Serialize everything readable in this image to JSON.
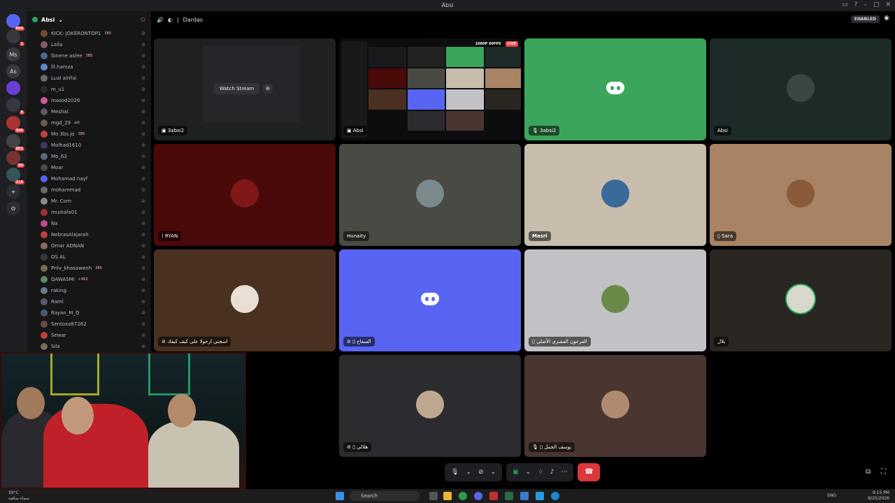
{
  "window": {
    "title": "Absi"
  },
  "server_rail": [
    {
      "label": "",
      "badge": "449"
    },
    {
      "label": "",
      "badge": "1"
    },
    {
      "label": "Ms",
      "badge": ""
    },
    {
      "label": "As",
      "badge": ""
    },
    {
      "label": "",
      "badge": ""
    },
    {
      "label": "",
      "badge": "5"
    },
    {
      "label": "",
      "badge": "345"
    },
    {
      "label": "",
      "badge": "201"
    },
    {
      "label": "",
      "badge": "59"
    },
    {
      "label": "",
      "badge": "115"
    }
  ],
  "sidebar": {
    "server_name": "Absi",
    "members": [
      {
        "name": "KICK: JOKERONTOP1",
        "tag": "3BS"
      },
      {
        "name": "Laila",
        "tag": ""
      },
      {
        "name": "lbnene aslee",
        "tag": "3BS"
      },
      {
        "name": "lll.hamza",
        "tag": ""
      },
      {
        "name": "Lual alrifai",
        "tag": ""
      },
      {
        "name": "m_u1",
        "tag": ""
      },
      {
        "name": "masod2026",
        "tag": ""
      },
      {
        "name": "Meshal.",
        "tag": ""
      },
      {
        "name": "mgd_29",
        "tag": "al0"
      },
      {
        "name": "Mo 3bs.jo",
        "tag": "3BS"
      },
      {
        "name": "Molhad1610",
        "tag": ""
      },
      {
        "name": "Mo_63",
        "tag": ""
      },
      {
        "name": "Moar",
        "tag": ""
      },
      {
        "name": "Mohamad nayf",
        "tag": ""
      },
      {
        "name": "mohammad",
        "tag": ""
      },
      {
        "name": "Mr. Corn",
        "tag": ""
      },
      {
        "name": "mustafa01",
        "tag": ""
      },
      {
        "name": "Na",
        "tag": ""
      },
      {
        "name": "NebrasAlajarah",
        "tag": ""
      },
      {
        "name": "Omar ADNAN",
        "tag": ""
      },
      {
        "name": "OS AL",
        "tag": ""
      },
      {
        "name": "Priiv_khasawenh",
        "tag": "3BS"
      },
      {
        "name": "QAWASMI",
        "tag": "+962"
      },
      {
        "name": "raking",
        "tag": ""
      },
      {
        "name": "Rami",
        "tag": ""
      },
      {
        "name": "Rayan_M_Q",
        "tag": ""
      },
      {
        "name": "Sentoxa87262",
        "tag": ""
      },
      {
        "name": "Sewar",
        "tag": ""
      },
      {
        "name": "Sila",
        "tag": ""
      }
    ]
  },
  "channel": {
    "name": "Dardas",
    "status": "ENABLED"
  },
  "stream_tiles": [
    {
      "user": "3absi2",
      "action": "Watch Stream"
    },
    {
      "user": "Absi",
      "quality": "1080P 60FPS",
      "live": "LIVE"
    }
  ],
  "participants": [
    {
      "name": "3absi2",
      "color": "#3ba55c",
      "logo": true
    },
    {
      "name": "Absi",
      "color": "#1c2a28"
    },
    {
      "name": "! RYAN",
      "color": "#4a0a0a"
    },
    {
      "name": "Hunaity",
      "color": "#4a4a44"
    },
    {
      "name": "Masri",
      "color": "#c8bcac"
    },
    {
      "name": "Sara",
      "color": "#a88464"
    },
    {
      "name": "اسجني ارجولا على كيف كيفك",
      "color": "#4a3020"
    },
    {
      "name": "السفاح",
      "color": "#5865f2",
      "logo": true
    },
    {
      "name": "الفرعون المصري الأصلي",
      "color": "#c2c2c6"
    },
    {
      "name": "بلال",
      "color": "#2a2622"
    },
    {
      "name": "هلالي",
      "color": "#2c2c30"
    },
    {
      "name": "يوسف الجمل",
      "color": "#4a3630"
    }
  ],
  "taskbar": {
    "search_placeholder": "Search",
    "language": "ENG",
    "time": "9:15 PM",
    "date": "8/25/2026",
    "weather_temp": "39°C",
    "weather_desc": "سماء صافية"
  }
}
